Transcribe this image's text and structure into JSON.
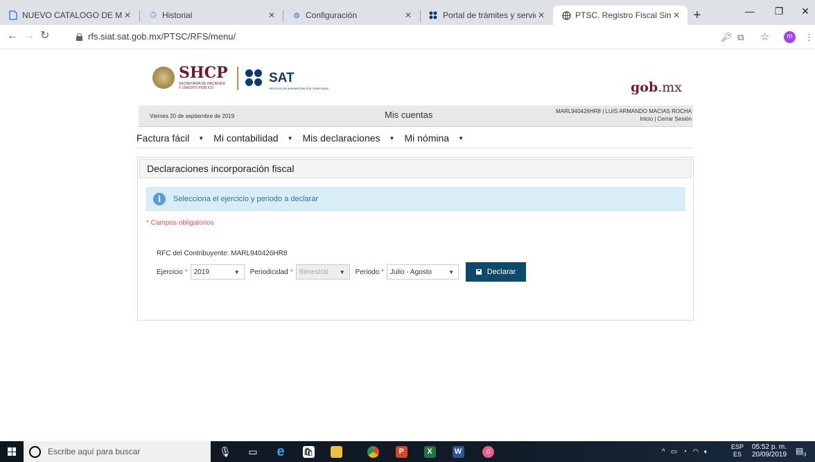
{
  "browser": {
    "tabs": [
      {
        "label": "NUEVO CATALOGO DE METOD",
        "icon": "document-icon",
        "active": false
      },
      {
        "label": "Historial",
        "icon": "history-icon",
        "active": false
      },
      {
        "label": "Configuración",
        "icon": "gear-icon",
        "active": false
      },
      {
        "label": "Portal de trámites y servicios -",
        "icon": "sat-icon",
        "active": false
      },
      {
        "label": "PTSC. Registro Fiscal Simplifica",
        "icon": "globe-icon",
        "active": true
      }
    ],
    "url": "rfs.siat.sat.gob.mx/PTSC/RFS/menu/",
    "profile_initial": "m"
  },
  "header": {
    "shcp": "SHCP",
    "shcp_sub": "SECRETARÍA DE HACIENDA Y CRÉDITO PÚBLICO",
    "sat": "SAT",
    "sat_sub": "SERVICIO DE ADMINISTRACIÓN TRIBUTARIA",
    "gob_bold": "gob",
    "gob_light": ".mx"
  },
  "infobar": {
    "date": "Viernes 20 de septiembre de 2019",
    "title": "Mis cuentas",
    "user": "MARL940426HR8 | LUIS ARMANDO MACIAS ROCHA",
    "links": "Inicio | Cerrar Sesión"
  },
  "menu": [
    {
      "label": "Factura fácil"
    },
    {
      "label": "Mi contabilidad"
    },
    {
      "label": "Mis declaraciones"
    },
    {
      "label": "Mi nómina"
    }
  ],
  "panel": {
    "title": "Declaraciones incorporación fiscal",
    "alert": "Selecciona el ejercicio y periodo a declarar",
    "required_note": "* Campos obligatorios",
    "rfc_label": "RFC del Contribuyente: MARL940426HR8",
    "ejercicio_label": "Ejercicio",
    "ejercicio_value": "2019",
    "periodicidad_label": "Periodicidad",
    "periodicidad_value": "Bimestral",
    "periodo_label": "Periodo",
    "periodo_value": "Julio - Agosto",
    "required_mark": "*",
    "declarar_label": "Declarar"
  },
  "taskbar": {
    "search_placeholder": "Escribe aquí para buscar",
    "lang_top": "ESP",
    "lang_bottom": "ES",
    "time": "05:52 p. m.",
    "date": "20/09/2019",
    "notif_count": "3"
  }
}
